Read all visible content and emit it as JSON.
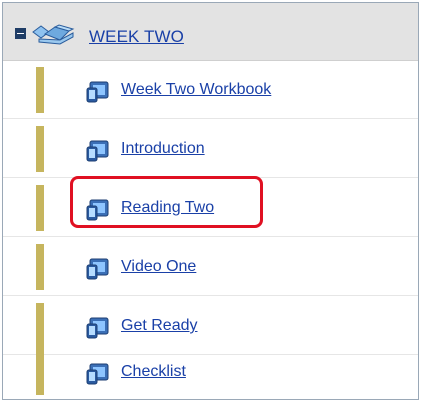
{
  "module": {
    "title": "WEEK TWO"
  },
  "items": [
    {
      "label": "Week Two Workbook"
    },
    {
      "label": "Introduction"
    },
    {
      "label": "Reading Two"
    },
    {
      "label": "Video One"
    },
    {
      "label": "Get Ready"
    },
    {
      "label": "Checklist"
    }
  ],
  "colors": {
    "link": "#1a40a7",
    "accent_bar": "#c6b55e",
    "highlight": "#e01022",
    "header_bg": "#e3e3e3"
  },
  "highlighted_item": "Reading Two"
}
